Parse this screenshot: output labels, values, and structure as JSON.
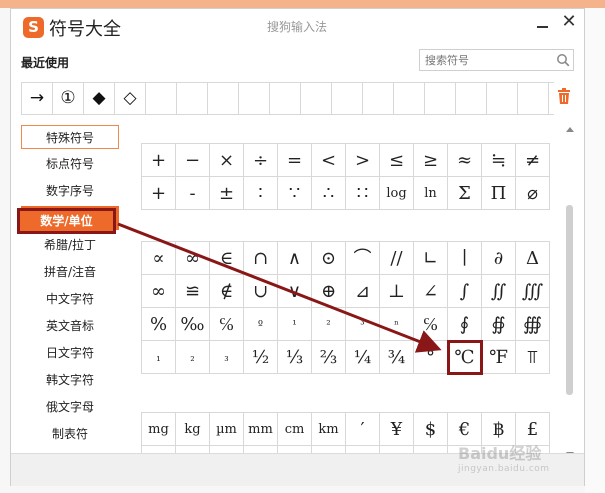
{
  "window": {
    "title": "符号大全",
    "logo_letter": "S",
    "ime_name": "搜狗输入法",
    "close_glyph": "✕"
  },
  "recent": {
    "label": "最近使用",
    "symbols": [
      "→",
      "①",
      "◆",
      "◇",
      "",
      "",
      "",
      "",
      "",
      "",
      "",
      "",
      "",
      "",
      "",
      "",
      ""
    ]
  },
  "search": {
    "placeholder": "搜索符号"
  },
  "categories": [
    "特殊符号",
    "标点符号",
    "数字序号",
    "数学/单位",
    "希腊/拉丁",
    "拼音/注音",
    "中文字符",
    "英文音标",
    "日文字符",
    "韩文字符",
    "俄文字母",
    "制表符"
  ],
  "active_category": "数学/单位",
  "grids": [
    {
      "rows": [
        [
          "+",
          "−",
          "×",
          "÷",
          "=",
          "<",
          ">",
          "≤",
          "≥",
          "≈",
          "≒",
          "≠"
        ],
        [
          "+",
          "-",
          "±",
          "∶",
          "∵",
          "∴",
          "∷",
          "log",
          "ln",
          "Σ",
          "Π",
          "⌀"
        ]
      ]
    },
    {
      "rows": [
        [
          "∝",
          "∞",
          "∈",
          "∩",
          "∧",
          "⊙",
          "⌒",
          "//",
          "∟",
          "∣",
          "∂",
          "Δ"
        ],
        [
          "∞",
          "≌",
          "∉",
          "∪",
          "∨",
          "⊕",
          "⊿",
          "⊥",
          "∠",
          "∫",
          "∬",
          "∭"
        ],
        [
          "%",
          "‰",
          "℅",
          "º",
          "¹",
          "²",
          "³",
          "ⁿ",
          "℅",
          "∮",
          "∯",
          "∰"
        ],
        [
          "₁",
          "₂",
          "₃",
          "½",
          "⅓",
          "⅔",
          "¼",
          "¾",
          "°",
          "℃",
          "℉",
          "⫪"
        ]
      ]
    },
    {
      "rows": [
        [
          "mg",
          "kg",
          "µm",
          "mm",
          "cm",
          "km",
          "′",
          "¥",
          "$",
          "€",
          "฿",
          "£"
        ],
        [
          "",
          "",
          "",
          "",
          "",
          "",
          "",
          "",
          "",
          "",
          "",
          ""
        ]
      ]
    }
  ],
  "highlighted_symbol": "℃",
  "watermark": {
    "main": "Baidu经验",
    "sub": "jingyan.baidu.com"
  },
  "colors": {
    "brand": "#ee6a2a",
    "annotation": "#8a1717"
  }
}
